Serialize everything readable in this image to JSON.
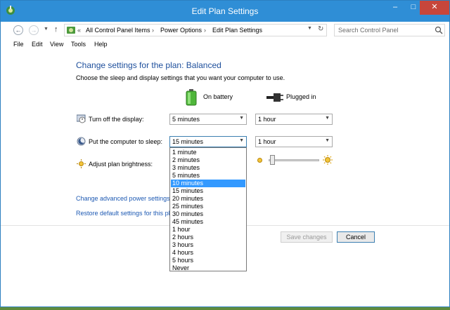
{
  "window": {
    "title": "Edit Plan Settings",
    "controls": {
      "minimize": "–",
      "maximize": "□",
      "close": "✕"
    }
  },
  "address_bar": {
    "separator": "«",
    "chevron": "›",
    "breadcrumbs": [
      "All Control Panel Items",
      "Power Options",
      "Edit Plan Settings"
    ],
    "search_placeholder": "Search Control Panel"
  },
  "menu": [
    "File",
    "Edit",
    "View",
    "Tools",
    "Help"
  ],
  "main": {
    "heading": "Change settings for the plan: Balanced",
    "subtext": "Choose the sleep and display settings that you want your computer to use.",
    "columns": {
      "battery": "On battery",
      "plugged": "Plugged in"
    },
    "rows": {
      "display": {
        "label": "Turn off the display:",
        "battery_value": "5 minutes",
        "plugged_value": "1 hour"
      },
      "sleep": {
        "label": "Put the computer to sleep:",
        "battery_value": "15 minutes",
        "plugged_value": "1 hour"
      },
      "brightness": {
        "label": "Adjust plan brightness:",
        "level": 0.05
      }
    },
    "links": {
      "advanced": "Change advanced power settings",
      "restore": "Restore default settings for this pla"
    }
  },
  "footer": {
    "save": "Save changes",
    "cancel": "Cancel"
  },
  "dropdown": {
    "options": [
      "1 minute",
      "2 minutes",
      "3 minutes",
      "5 minutes",
      "10 minutes",
      "15 minutes",
      "20 minutes",
      "25 minutes",
      "30 minutes",
      "45 minutes",
      "1 hour",
      "2 hours",
      "3 hours",
      "4 hours",
      "5 hours",
      "Never"
    ],
    "highlighted": "10 minutes"
  },
  "colors": {
    "title_bar": "#2f8ed6",
    "heading": "#1e4f9c",
    "link": "#1e5ab3",
    "highlight": "#3399ff",
    "close_button": "#c7463b"
  }
}
